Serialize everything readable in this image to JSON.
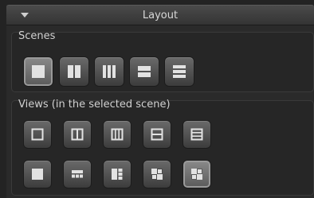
{
  "panel": {
    "title": "Layout"
  },
  "scenes": {
    "label": "Scenes",
    "items": [
      {
        "icon": "layout-single-icon",
        "active": true
      },
      {
        "icon": "layout-two-columns-icon",
        "active": false
      },
      {
        "icon": "layout-three-columns-icon",
        "active": false
      },
      {
        "icon": "layout-two-rows-icon",
        "active": false
      },
      {
        "icon": "layout-three-rows-icon",
        "active": false
      }
    ]
  },
  "views": {
    "label": "Views (in the selected scene)",
    "row1": [
      {
        "icon": "view-single-icon",
        "active": false
      },
      {
        "icon": "view-two-columns-icon",
        "active": false
      },
      {
        "icon": "view-three-columns-icon",
        "active": false
      },
      {
        "icon": "view-two-rows-icon",
        "active": false
      },
      {
        "icon": "view-three-rows-icon",
        "active": false
      }
    ],
    "row2": [
      {
        "icon": "view-large-single-icon",
        "active": false
      },
      {
        "icon": "view-top-strip-icon",
        "active": false
      },
      {
        "icon": "view-side-strip-icon",
        "active": false
      },
      {
        "icon": "view-quad-split-icon",
        "active": false
      },
      {
        "icon": "view-quad-icon",
        "active": true
      }
    ]
  },
  "colors": {
    "background": "#232323",
    "icon": "#e2e2e2",
    "header": "#3e3e3e"
  }
}
